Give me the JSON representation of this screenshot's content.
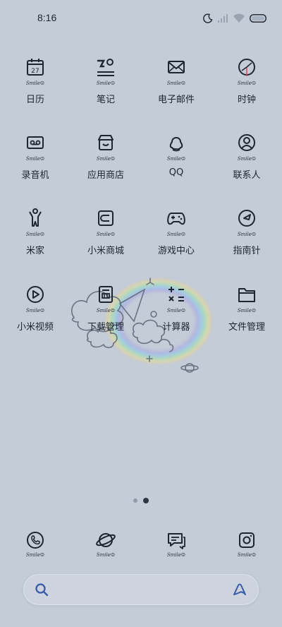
{
  "status_bar": {
    "time": "8:16"
  },
  "apps": [
    {
      "label": "日历",
      "icon": "calendar-icon"
    },
    {
      "label": "笔记",
      "icon": "notes-icon"
    },
    {
      "label": "电子邮件",
      "icon": "mail-icon"
    },
    {
      "label": "时钟",
      "icon": "clock-icon"
    },
    {
      "label": "录音机",
      "icon": "recorder-icon"
    },
    {
      "label": "应用商店",
      "icon": "app-store-icon"
    },
    {
      "label": "QQ",
      "icon": "qq-icon"
    },
    {
      "label": "联系人",
      "icon": "contacts-icon"
    },
    {
      "label": "米家",
      "icon": "mijia-icon"
    },
    {
      "label": "小米商城",
      "icon": "mi-store-icon"
    },
    {
      "label": "游戏中心",
      "icon": "game-center-icon"
    },
    {
      "label": "指南针",
      "icon": "compass-icon"
    },
    {
      "label": "小米视频",
      "icon": "video-icon"
    },
    {
      "label": "下载管理",
      "icon": "download-icon"
    },
    {
      "label": "计算器",
      "icon": "calculator-icon"
    },
    {
      "label": "文件管理",
      "icon": "file-manager-icon"
    }
  ],
  "icon_caption": "Smile☺",
  "calendar_day": "27",
  "dock": [
    {
      "icon": "phone-icon"
    },
    {
      "icon": "browser-icon"
    },
    {
      "icon": "messages-icon"
    },
    {
      "icon": "camera-icon"
    }
  ],
  "page_indicator": {
    "pages": 2,
    "current": 2
  }
}
